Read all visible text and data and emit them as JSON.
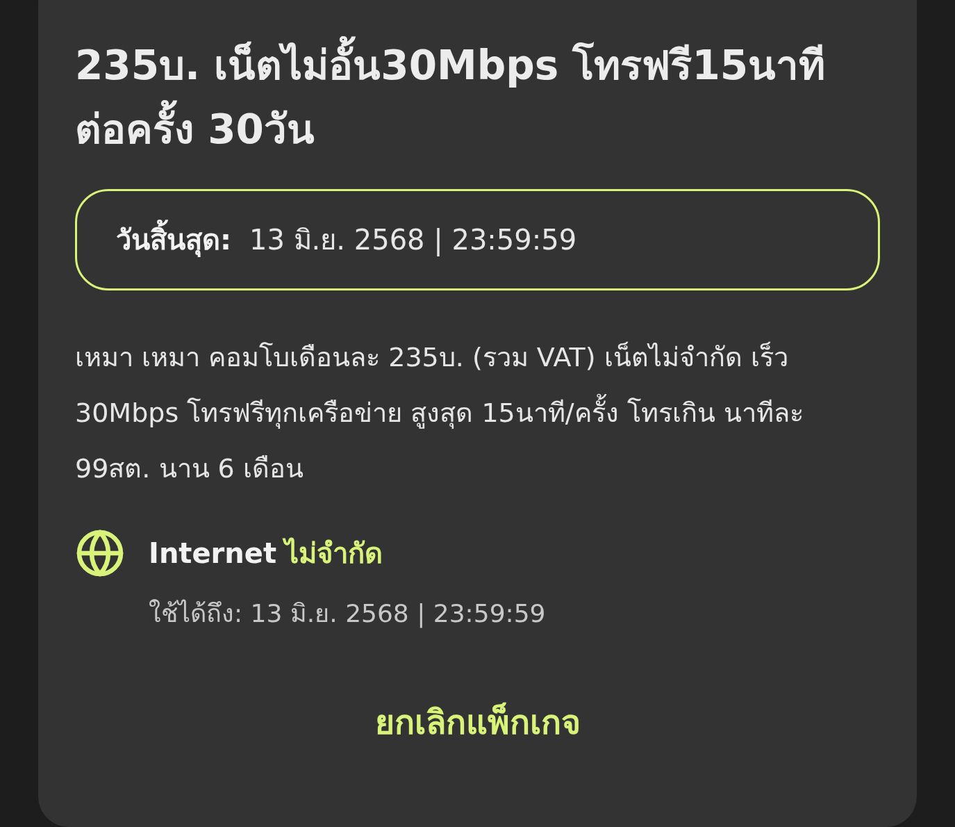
{
  "title": "235บ. เน็ตไม่อั้น30Mbps โทรฟรี15นาทีต่อครั้ง 30วัน",
  "expiry": {
    "label": "วันสิ้นสุด:",
    "value": "13 มิ.ย. 2568 | 23:59:59"
  },
  "description": "เหมา เหมา คอมโบเดือนละ 235บ. (รวม VAT) เน็ตไม่จำกัด เร็ว 30Mbps โทรฟรีทุกเครือข่าย สูงสุด 15นาที/ครั้ง โทรเกิน นาทีละ 99สต. นาน 6 เดือน",
  "benefits": [
    {
      "kind": "internet",
      "name": "Internet",
      "value": "ไม่จำกัด",
      "valid_until": "ใช้ได้ถึง: 13 มิ.ย. 2568 | 23:59:59"
    }
  ],
  "cancel_button": "ยกเลิกแพ็กเกจ"
}
